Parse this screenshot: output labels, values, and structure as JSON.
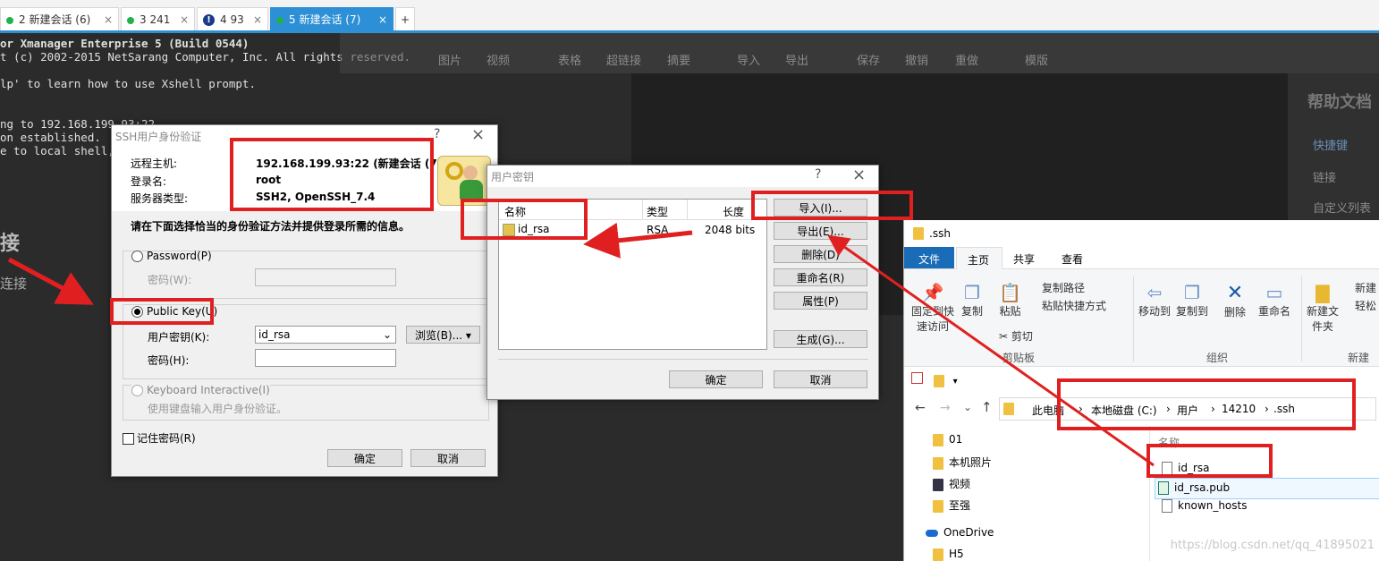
{
  "tabs": [
    {
      "label": "2 新建会话 (6)",
      "icon": "green-dot"
    },
    {
      "label": "3 241",
      "icon": "green-dot"
    },
    {
      "label": "4 93",
      "icon": "warning-icon"
    },
    {
      "label": "5 新建会话 (7)",
      "icon": "green-dot"
    }
  ],
  "add_tab_label": "+",
  "terminal_lines": [
    "or Xmanager Enterprise 5 (Build 0544)",
    "t (c) 2002-2015 NetSarang Computer, Inc. All rights reserved.",
    "",
    "lp' to learn how to use Xshell prompt.",
    "",
    "ng to 192.168.199.93:22...",
    "on established.",
    "e to local shell,"
  ],
  "ghost_toolbar": [
    "图片",
    "视频",
    "表格",
    "超链接",
    "摘要",
    "导入",
    "导出",
    "保存",
    "撤销",
    "重做",
    "模版"
  ],
  "ghost_side": [
    "帮助文档",
    "快捷键",
    "链接",
    "自定义列表"
  ],
  "ghost_left": [
    "接",
    "连接"
  ],
  "auth_dialog": {
    "title": "SSH用户身份验证",
    "help": "?",
    "close": "×",
    "remote_host_label": "远程主机:",
    "remote_host_value": "192.168.199.93:22 (新建会话 (7))",
    "login_label": "登录名:",
    "login_value": "root",
    "server_type_label": "服务器类型:",
    "server_type_value": "SSH2, OpenSSH_7.4",
    "instruction": "请在下面选择恰当的身份验证方法并提供登录所需的信息。",
    "password_option": "Password(P)",
    "password_label": "密码(W):",
    "publickey_option": "Public Key(U)",
    "user_key_label": "用户密钥(K):",
    "user_key_value": "id_rsa",
    "browse_button": "浏览(B)...",
    "passphrase_label": "密码(H):",
    "keyboard_option": "Keyboard Interactive(I)",
    "keyboard_desc": "使用键盘输入用户身份验证。",
    "remember_label": "记住密码(R)",
    "ok": "确定",
    "cancel": "取消"
  },
  "key_dialog": {
    "title": "用户密钥",
    "help": "?",
    "close": "×",
    "columns": [
      "名称",
      "类型",
      "长度"
    ],
    "rows": [
      {
        "name": "id_rsa",
        "type": "RSA",
        "length": "2048 bits"
      }
    ],
    "import": "导入(I)...",
    "export": "导出(E)...",
    "delete": "删除(D)",
    "rename": "重命名(R)",
    "properties": "属性(P)",
    "generate": "生成(G)...",
    "ok": "确定",
    "cancel": "取消"
  },
  "explorer": {
    "title": ".ssh",
    "ribbon_tabs": [
      "文件",
      "主页",
      "共享",
      "查看"
    ],
    "ribbon_items": [
      "固定到快速访问",
      "复制",
      "粘贴",
      "复制路径",
      "粘贴快捷方式",
      "剪切",
      "移动到",
      "复制到",
      "删除",
      "重命名",
      "新建文件夹",
      "新建",
      "轻松"
    ],
    "ribbon_groups": [
      "剪贴板",
      "组织",
      "新建"
    ],
    "breadcrumb": [
      "此电脑",
      "本地磁盘 (C:)",
      "用户",
      "14210",
      ".ssh"
    ],
    "nav": [
      "01",
      "本机照片",
      "视频",
      "至强",
      "OneDrive",
      "H5"
    ],
    "column_header": "名称",
    "files": [
      "id_rsa",
      "id_rsa.pub",
      "known_hosts"
    ],
    "watermark": "https://blog.csdn.net/qq_41895021"
  },
  "colors": {
    "accent": "#2d8fd5",
    "annotation_red": "#e02020",
    "terminal_bg": "#2b2b2b"
  }
}
